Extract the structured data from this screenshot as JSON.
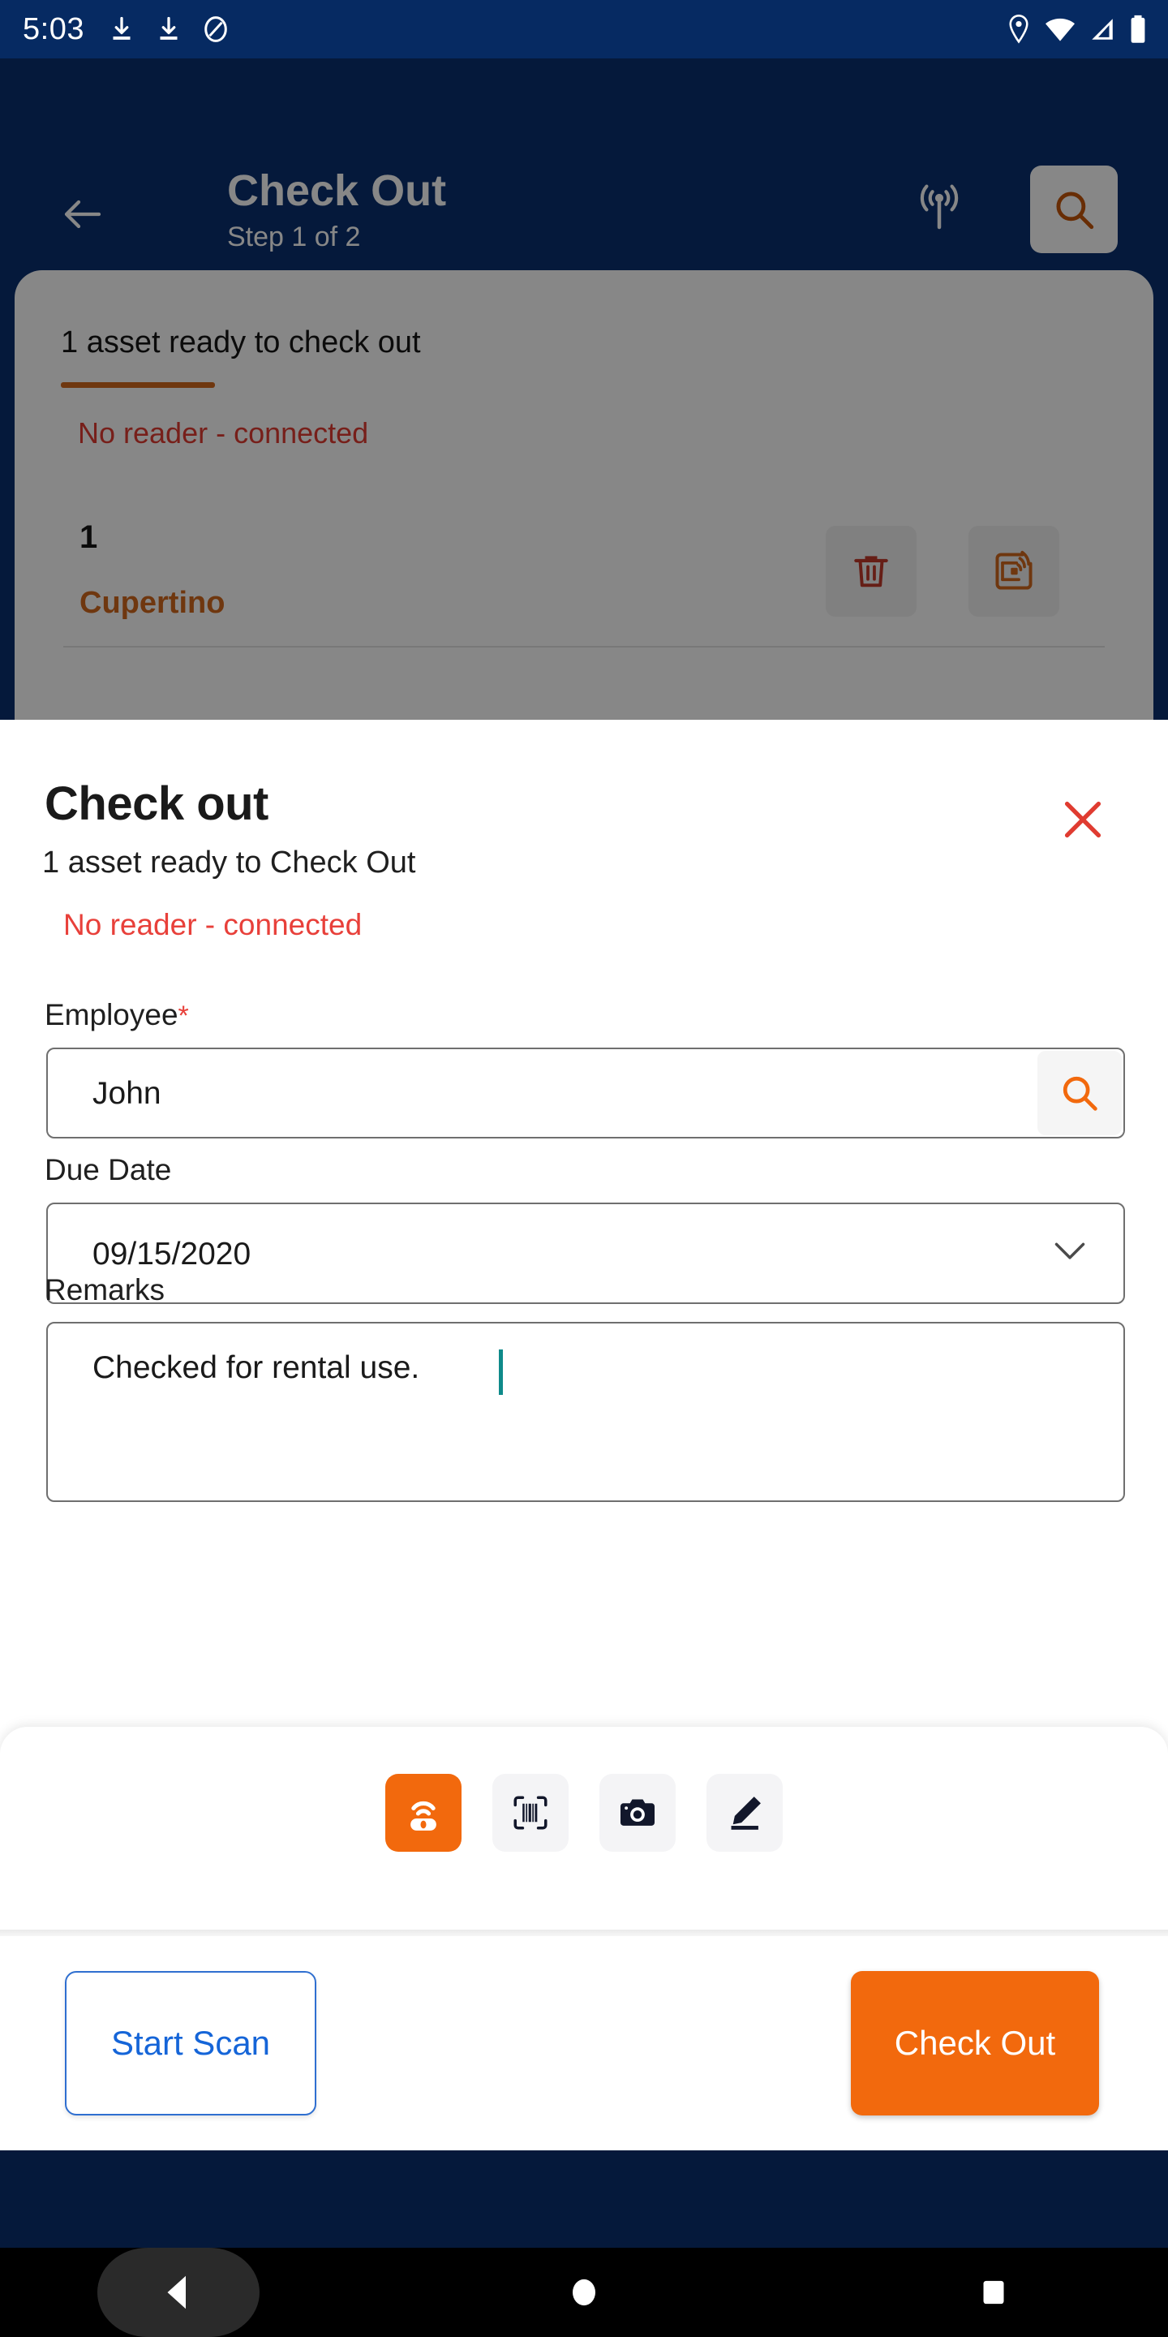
{
  "status_bar": {
    "time": "5:03",
    "left_icons": [
      "download-icon",
      "download-icon",
      "do-not-disturb-icon"
    ],
    "right_icons": [
      "location-pin-icon",
      "wifi-icon",
      "cellular-signal-icon",
      "battery-icon"
    ]
  },
  "app_bar": {
    "back_icon": "arrow-left-icon",
    "title": "Check Out",
    "subtitle": "Step 1 of 2",
    "antenna_icon": "rfid-antenna-icon",
    "search_icon": "search-icon"
  },
  "background_card": {
    "heading": "1 asset ready to check out",
    "reader_status": "No reader - connected",
    "row": {
      "index": "1",
      "name": "Cupertino",
      "delete_icon": "trash-icon",
      "rfid_icon": "rfid-tag-icon"
    }
  },
  "sheet": {
    "title": "Check out",
    "subtitle": "1 asset ready to Check Out",
    "reader_status": "No reader - connected",
    "close_icon": "close-icon",
    "form": {
      "employee": {
        "label": "Employee",
        "required_marker": "*",
        "value": "John",
        "placeholder": "Employee",
        "search_icon": "search-icon"
      },
      "due_date": {
        "label": "Due Date",
        "value": "09/15/2020",
        "placeholder": "Due Date",
        "chevron_icon": "chevron-down-icon"
      },
      "remarks": {
        "label": "Remarks",
        "value": "Checked for rental use.",
        "placeholder": "Remarks"
      }
    },
    "scan_modes": [
      {
        "name": "rfid-reader",
        "icon": "rfid-reader-icon",
        "active": true
      },
      {
        "name": "barcode",
        "icon": "barcode-scan-icon",
        "active": false
      },
      {
        "name": "camera",
        "icon": "camera-icon",
        "active": false
      },
      {
        "name": "manual-entry",
        "icon": "pencil-icon",
        "active": false
      }
    ],
    "actions": {
      "secondary_label": "Start Scan",
      "primary_label": "Check Out"
    }
  },
  "nav_bar": {
    "back_icon": "triangle-back-icon",
    "home_icon": "circle-home-icon",
    "recents_icon": "square-recents-icon"
  },
  "colors": {
    "brand_orange": "#F2690D",
    "app_bar_blue": "#0A3070",
    "status_bar_blue": "#062A62",
    "error_red": "#E8403A",
    "link_blue": "#1565D8",
    "caret_teal": "#0E8A8A",
    "field_border": "#6F6F6F"
  }
}
